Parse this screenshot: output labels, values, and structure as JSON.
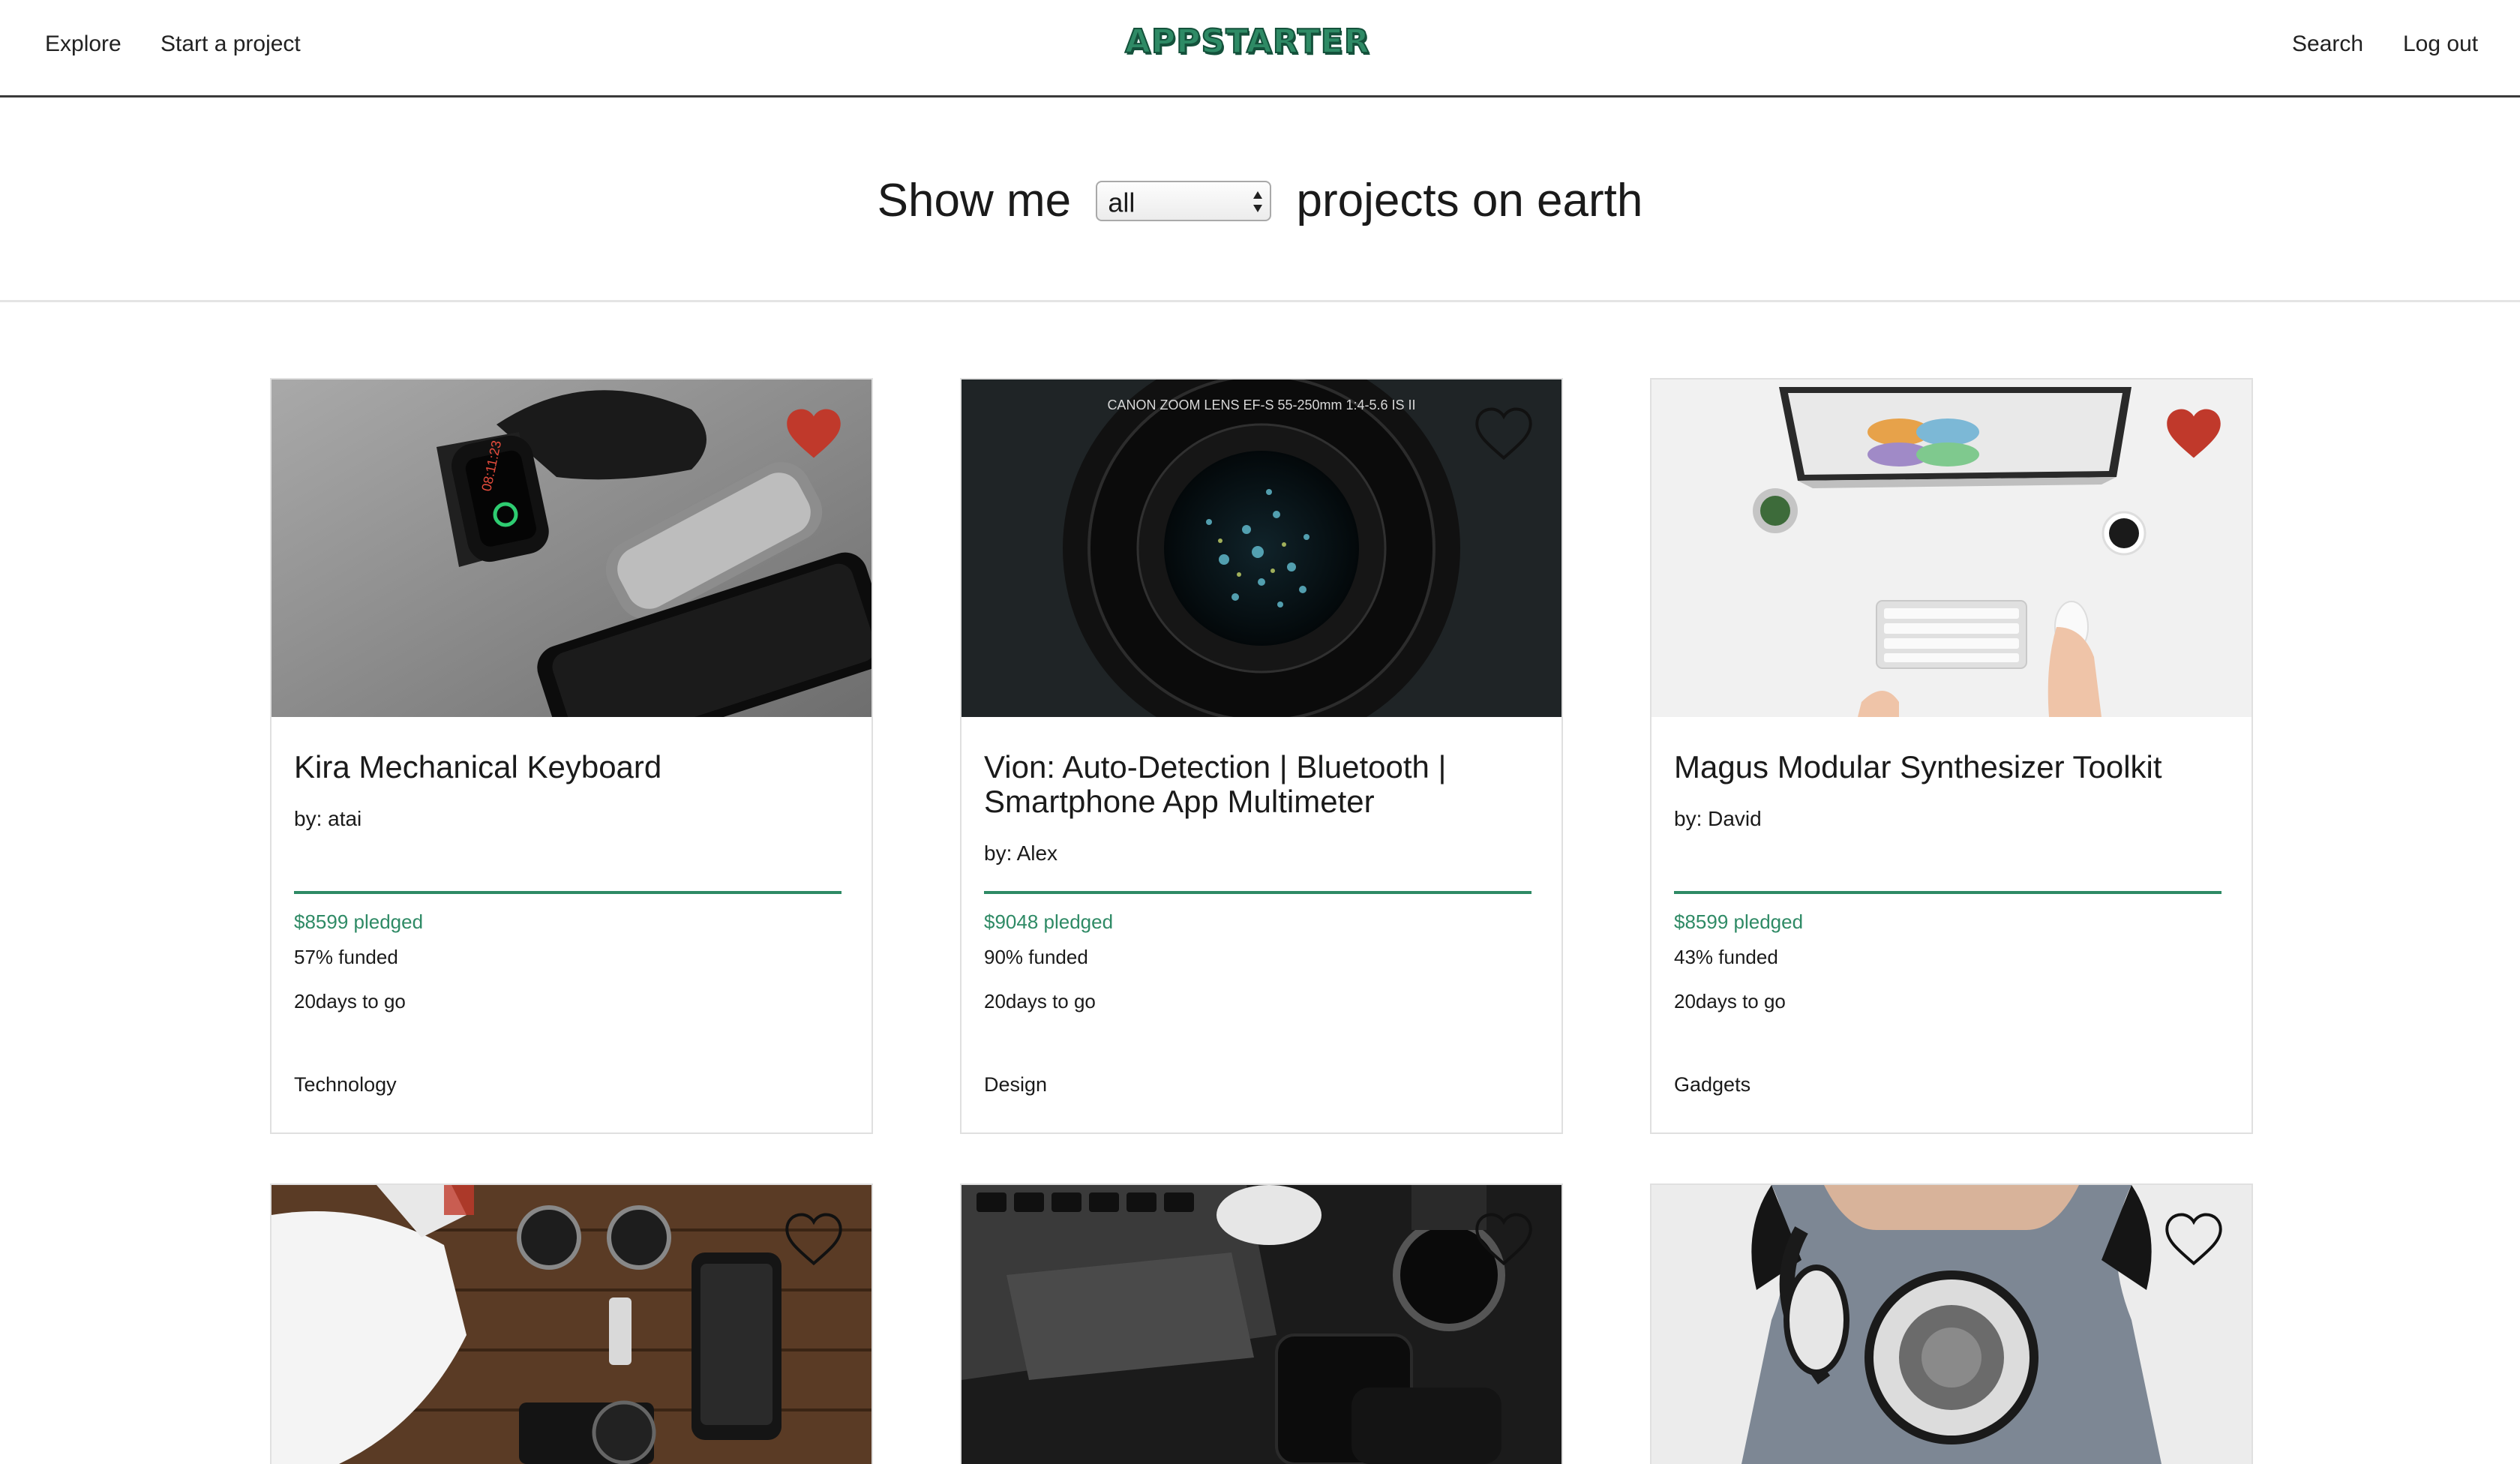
{
  "nav": {
    "explore": "Explore",
    "start_project": "Start a project",
    "logo": "APPSTARTER",
    "search": "Search",
    "logout": "Log out"
  },
  "filter": {
    "prefix": "Show me",
    "selected": "all",
    "suffix": "projects on earth"
  },
  "colors": {
    "accent": "#2e8a65",
    "heart_filled": "#c0392b"
  },
  "projects": [
    {
      "title": "Kira Mechanical Keyboard",
      "by": "by: atai",
      "pledged": "$8599 pledged",
      "funded": "57% funded",
      "days": "20days to go",
      "category": "Technology",
      "favorited": true,
      "image": "smartwatch-and-phones-photo"
    },
    {
      "title": "Vion: Auto-Detection | Bluetooth | Smartphone App Multimeter",
      "by": "by: Alex",
      "pledged": "$9048 pledged",
      "funded": "90% funded",
      "days": "20days to go",
      "category": "Design",
      "favorited": false,
      "image": "camera-lens-photo",
      "lens_text": "CANON ZOOM LENS EF-S 55-250mm 1:4-5.6 IS II"
    },
    {
      "title": "Magus Modular Synthesizer Toolkit",
      "by": "by: David",
      "pledged": "$8599 pledged",
      "funded": "43% funded",
      "days": "20days to go",
      "category": "Gadgets",
      "favorited": true,
      "image": "desktop-workspace-photo"
    },
    {
      "favorited": false,
      "image": "drone-and-camera-gear-photo"
    },
    {
      "favorited": false,
      "image": "laptop-phone-watch-photo"
    },
    {
      "favorited": false,
      "image": "headphones-person-photo"
    }
  ]
}
